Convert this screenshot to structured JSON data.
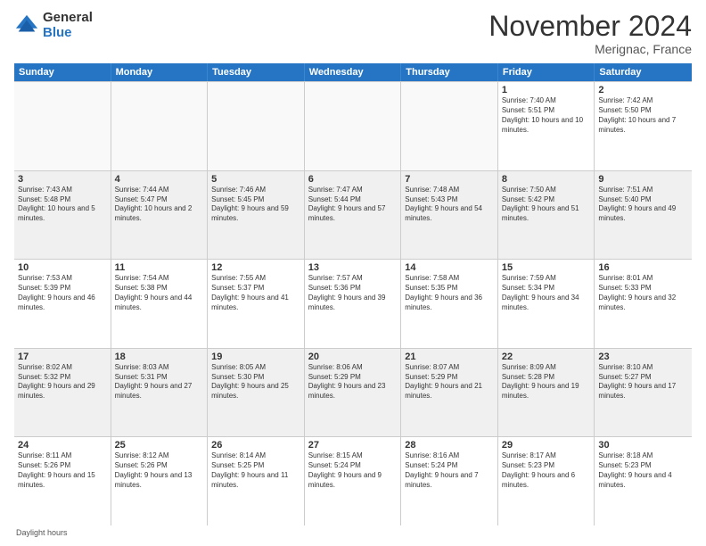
{
  "logo": {
    "general": "General",
    "blue": "Blue"
  },
  "header": {
    "month": "November 2024",
    "location": "Merignac, France"
  },
  "weekdays": [
    "Sunday",
    "Monday",
    "Tuesday",
    "Wednesday",
    "Thursday",
    "Friday",
    "Saturday"
  ],
  "footer": {
    "daylight_label": "Daylight hours"
  },
  "weeks": [
    [
      {
        "day": "",
        "info": ""
      },
      {
        "day": "",
        "info": ""
      },
      {
        "day": "",
        "info": ""
      },
      {
        "day": "",
        "info": ""
      },
      {
        "day": "",
        "info": ""
      },
      {
        "day": "1",
        "info": "Sunrise: 7:40 AM\nSunset: 5:51 PM\nDaylight: 10 hours and 10 minutes."
      },
      {
        "day": "2",
        "info": "Sunrise: 7:42 AM\nSunset: 5:50 PM\nDaylight: 10 hours and 7 minutes."
      }
    ],
    [
      {
        "day": "3",
        "info": "Sunrise: 7:43 AM\nSunset: 5:48 PM\nDaylight: 10 hours and 5 minutes."
      },
      {
        "day": "4",
        "info": "Sunrise: 7:44 AM\nSunset: 5:47 PM\nDaylight: 10 hours and 2 minutes."
      },
      {
        "day": "5",
        "info": "Sunrise: 7:46 AM\nSunset: 5:45 PM\nDaylight: 9 hours and 59 minutes."
      },
      {
        "day": "6",
        "info": "Sunrise: 7:47 AM\nSunset: 5:44 PM\nDaylight: 9 hours and 57 minutes."
      },
      {
        "day": "7",
        "info": "Sunrise: 7:48 AM\nSunset: 5:43 PM\nDaylight: 9 hours and 54 minutes."
      },
      {
        "day": "8",
        "info": "Sunrise: 7:50 AM\nSunset: 5:42 PM\nDaylight: 9 hours and 51 minutes."
      },
      {
        "day": "9",
        "info": "Sunrise: 7:51 AM\nSunset: 5:40 PM\nDaylight: 9 hours and 49 minutes."
      }
    ],
    [
      {
        "day": "10",
        "info": "Sunrise: 7:53 AM\nSunset: 5:39 PM\nDaylight: 9 hours and 46 minutes."
      },
      {
        "day": "11",
        "info": "Sunrise: 7:54 AM\nSunset: 5:38 PM\nDaylight: 9 hours and 44 minutes."
      },
      {
        "day": "12",
        "info": "Sunrise: 7:55 AM\nSunset: 5:37 PM\nDaylight: 9 hours and 41 minutes."
      },
      {
        "day": "13",
        "info": "Sunrise: 7:57 AM\nSunset: 5:36 PM\nDaylight: 9 hours and 39 minutes."
      },
      {
        "day": "14",
        "info": "Sunrise: 7:58 AM\nSunset: 5:35 PM\nDaylight: 9 hours and 36 minutes."
      },
      {
        "day": "15",
        "info": "Sunrise: 7:59 AM\nSunset: 5:34 PM\nDaylight: 9 hours and 34 minutes."
      },
      {
        "day": "16",
        "info": "Sunrise: 8:01 AM\nSunset: 5:33 PM\nDaylight: 9 hours and 32 minutes."
      }
    ],
    [
      {
        "day": "17",
        "info": "Sunrise: 8:02 AM\nSunset: 5:32 PM\nDaylight: 9 hours and 29 minutes."
      },
      {
        "day": "18",
        "info": "Sunrise: 8:03 AM\nSunset: 5:31 PM\nDaylight: 9 hours and 27 minutes."
      },
      {
        "day": "19",
        "info": "Sunrise: 8:05 AM\nSunset: 5:30 PM\nDaylight: 9 hours and 25 minutes."
      },
      {
        "day": "20",
        "info": "Sunrise: 8:06 AM\nSunset: 5:29 PM\nDaylight: 9 hours and 23 minutes."
      },
      {
        "day": "21",
        "info": "Sunrise: 8:07 AM\nSunset: 5:29 PM\nDaylight: 9 hours and 21 minutes."
      },
      {
        "day": "22",
        "info": "Sunrise: 8:09 AM\nSunset: 5:28 PM\nDaylight: 9 hours and 19 minutes."
      },
      {
        "day": "23",
        "info": "Sunrise: 8:10 AM\nSunset: 5:27 PM\nDaylight: 9 hours and 17 minutes."
      }
    ],
    [
      {
        "day": "24",
        "info": "Sunrise: 8:11 AM\nSunset: 5:26 PM\nDaylight: 9 hours and 15 minutes."
      },
      {
        "day": "25",
        "info": "Sunrise: 8:12 AM\nSunset: 5:26 PM\nDaylight: 9 hours and 13 minutes."
      },
      {
        "day": "26",
        "info": "Sunrise: 8:14 AM\nSunset: 5:25 PM\nDaylight: 9 hours and 11 minutes."
      },
      {
        "day": "27",
        "info": "Sunrise: 8:15 AM\nSunset: 5:24 PM\nDaylight: 9 hours and 9 minutes."
      },
      {
        "day": "28",
        "info": "Sunrise: 8:16 AM\nSunset: 5:24 PM\nDaylight: 9 hours and 7 minutes."
      },
      {
        "day": "29",
        "info": "Sunrise: 8:17 AM\nSunset: 5:23 PM\nDaylight: 9 hours and 6 minutes."
      },
      {
        "day": "30",
        "info": "Sunrise: 8:18 AM\nSunset: 5:23 PM\nDaylight: 9 hours and 4 minutes."
      }
    ]
  ]
}
